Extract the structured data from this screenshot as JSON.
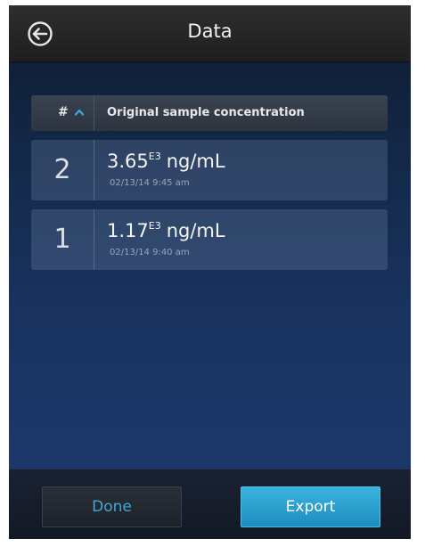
{
  "header": {
    "title": "Data",
    "back_icon": "back-arrow-circle-icon"
  },
  "table": {
    "columns": {
      "number": "#",
      "concentration": "Original sample concentration"
    },
    "sort_icon": "chevron-up-icon",
    "rows": [
      {
        "number": "2",
        "value": "3.65",
        "exponent": "E3",
        "unit": "ng/mL",
        "timestamp": "02/13/14 9:45 am"
      },
      {
        "number": "1",
        "value": "1.17",
        "exponent": "E3",
        "unit": "ng/mL",
        "timestamp": "02/13/14 9:40 am"
      }
    ]
  },
  "footer": {
    "done_label": "Done",
    "export_label": "Export"
  },
  "colors": {
    "accent": "#3ea9d8",
    "export_button": "#2a9fd0"
  }
}
